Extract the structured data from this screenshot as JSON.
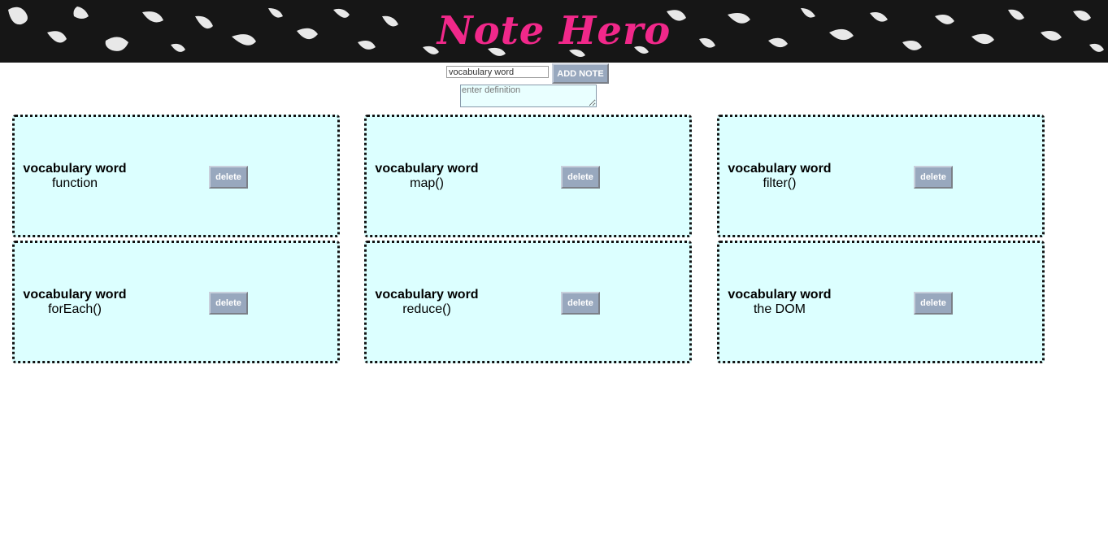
{
  "header": {
    "title": "Note Hero"
  },
  "form": {
    "word_value": "vocabulary word",
    "add_label": "ADD NOTE",
    "definition_placeholder": "enter definition"
  },
  "colors": {
    "title": "#f1288a",
    "card_background": "#dcffff",
    "button": "#98a8be"
  },
  "notes": [
    {
      "word": "vocabulary word",
      "definition": "function",
      "delete_label": "delete"
    },
    {
      "word": "vocabulary word",
      "definition": "map()",
      "delete_label": "delete"
    },
    {
      "word": "vocabulary word",
      "definition": "filter()",
      "delete_label": "delete"
    },
    {
      "word": "vocabulary word",
      "definition": "forEach()",
      "delete_label": "delete"
    },
    {
      "word": "vocabulary word",
      "definition": "reduce()",
      "delete_label": "delete"
    },
    {
      "word": "vocabulary word",
      "definition": "the DOM",
      "delete_label": "delete"
    }
  ]
}
